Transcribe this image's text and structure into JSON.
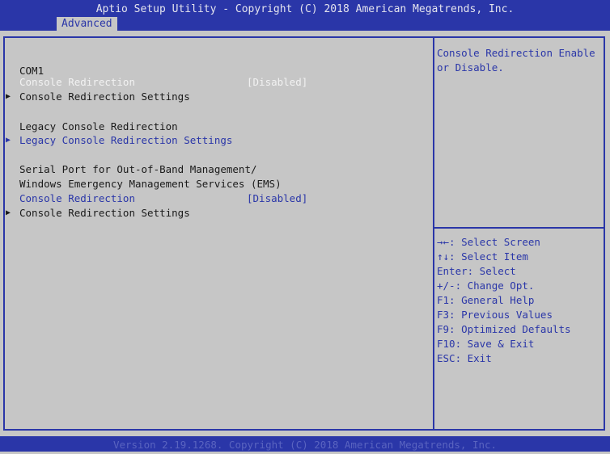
{
  "header": {
    "title": "Aptio Setup Utility - Copyright (C) 2018 American Megatrends, Inc.",
    "tab": "Advanced"
  },
  "main": {
    "com1": {
      "heading": "COM1",
      "redirect_label": "Console Redirection",
      "redirect_value": "[Disabled]",
      "settings_label": "Console Redirection Settings"
    },
    "legacy": {
      "heading": "Legacy Console Redirection",
      "settings_label": "Legacy Console Redirection Settings"
    },
    "ems": {
      "heading_line1": "Serial Port for Out-of-Band Management/",
      "heading_line2": "Windows Emergency Management Services (EMS)",
      "redirect_label": "Console Redirection",
      "redirect_value": "[Disabled]",
      "settings_label": "Console Redirection Settings"
    }
  },
  "help": {
    "line1": "Console Redirection Enable",
    "line2": "or Disable."
  },
  "keys": [
    "→←: Select Screen",
    "↑↓: Select Item",
    "Enter: Select",
    "+/-: Change Opt.",
    "F1: General Help",
    "F3: Previous Values",
    "F9: Optimized Defaults",
    "F10: Save & Exit",
    "ESC: Exit"
  ],
  "footer": {
    "text": "Version 2.19.1268. Copyright (C) 2018 American Megatrends, Inc."
  },
  "colors": {
    "bios_blue": "#2a36a8",
    "background_gray": "#c6c6c6",
    "highlight_white": "#f2f2f2"
  }
}
